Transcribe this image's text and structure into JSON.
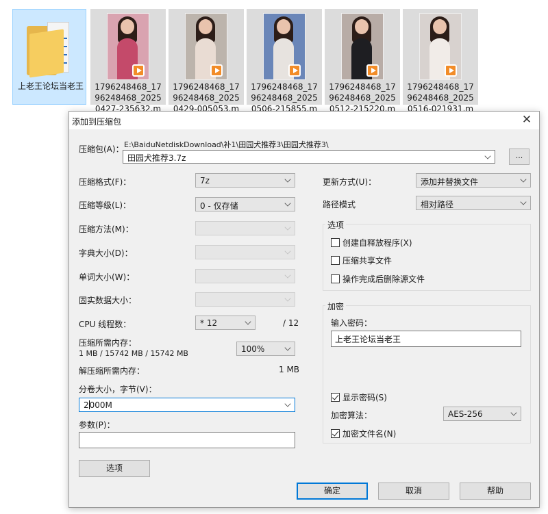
{
  "desktop": {
    "folder": {
      "name": "上老王论坛当老王"
    },
    "files": [
      {
        "name": "1796248468_1796248468_20250427-235632.m",
        "thumb_color": "#d9a3b0",
        "outfit_color": "#c44a6a"
      },
      {
        "name": "1796248468_1796248468_20250429-005053.m",
        "thumb_color": "#bcb4ac",
        "outfit_color": "#e9dcd3"
      },
      {
        "name": "1796248468_1796248468_20250506-215855.m",
        "thumb_color": "#6a86b8",
        "outfit_color": "#e7e3df"
      },
      {
        "name": "1796248468_1796248468_20250512-215220.m",
        "thumb_color": "#b8aca6",
        "outfit_color": "#1e1e22"
      },
      {
        "name": "1796248468_1796248468_20250516-021931.m",
        "thumb_color": "#d8d2cf",
        "outfit_color": "#f1ece8"
      }
    ]
  },
  "dialog": {
    "title": "添加到压缩包",
    "close_glyph": "✕",
    "archive": {
      "label": "压缩包(A)：",
      "path": "E:\\BaiduNetdiskDownload\\补1\\田园犬推荐3\\田园犬推荐3\\",
      "value": "田园犬推荐3.7z",
      "browse_label": "..."
    },
    "left": {
      "format": {
        "label": "压缩格式(F)：",
        "value": "7z"
      },
      "level": {
        "label": "压缩等级(L)：",
        "value": "0 - 仅存储"
      },
      "method": {
        "label": "压缩方法(M)：",
        "value": ""
      },
      "dict": {
        "label": "字典大小(D)：",
        "value": ""
      },
      "word": {
        "label": "单词大小(W)：",
        "value": ""
      },
      "solid": {
        "label": "固实数据大小：",
        "value": ""
      },
      "cpu": {
        "label": "CPU 线程数：",
        "value": "* 12",
        "max": "/ 12"
      },
      "mem": {
        "label": "压缩所需内存：",
        "detail": "1 MB / 15742 MB / 15742 MB",
        "value": "100%"
      },
      "decomp": {
        "label": "解压缩所需内存：",
        "value": "1 MB"
      },
      "split": {
        "label": "分卷大小，字节(V)：",
        "value_before": "2",
        "value_after": "000M"
      },
      "params": {
        "label": "参数(P)：",
        "value": ""
      },
      "options_button": "选项"
    },
    "right": {
      "update": {
        "label": "更新方式(U)：",
        "value": "添加并替换文件"
      },
      "pathmode": {
        "label": "路径模式",
        "value": "相对路径"
      },
      "options": {
        "title": "选项",
        "sfx": {
          "label": "创建自释放程序(X)",
          "checked": false
        },
        "shared": {
          "label": "压缩共享文件",
          "checked": false
        },
        "delete": {
          "label": "操作完成后删除源文件",
          "checked": false
        }
      },
      "encryption": {
        "title": "加密",
        "password_label": "输入密码：",
        "password_value": "上老王论坛当老王",
        "show_password": {
          "label": "显示密码(S)",
          "checked": true
        },
        "method_label": "加密算法：",
        "method_value": "AES-256",
        "encrypt_names": {
          "label": "加密文件名(N)",
          "checked": true
        }
      }
    },
    "buttons": {
      "ok": "确定",
      "cancel": "取消",
      "help": "帮助"
    }
  }
}
